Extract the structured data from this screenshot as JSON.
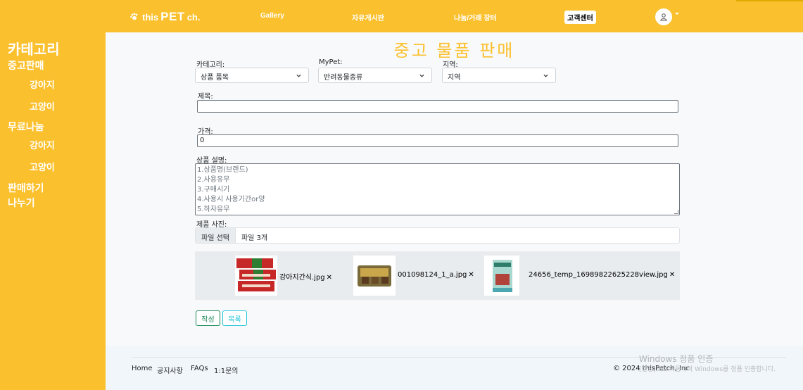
{
  "header": {
    "brand_prefix": "this",
    "brand_main": "PET",
    "brand_suffix": "ch.",
    "nav": [
      "Gallery",
      "자유게시판",
      "나눔/거래 장터"
    ],
    "customer_center": "고객센터",
    "accent_color": "#fbc02d"
  },
  "sidebar": {
    "title": "카테고리",
    "sections": [
      {
        "label": "중고판매",
        "items": [
          "강아지",
          "고양이"
        ]
      },
      {
        "label": "무료나눔",
        "items": [
          "강아지",
          "고양이"
        ]
      }
    ],
    "sell_label": "판매하기",
    "share_label": "나누기"
  },
  "page": {
    "title": "중고 물품 판매"
  },
  "form": {
    "category_label": "카테고리:",
    "category_value": "상품 품목",
    "mypet_label": "MyPet:",
    "mypet_value": "반려동물종류",
    "region_label": "지역:",
    "region_value": "지역",
    "title_label": "제목:",
    "title_value": "",
    "price_label": "가격:",
    "price_value": "0",
    "description_label": "상품 설명:",
    "description_placeholder_lines": [
      "1.상품명(브랜드)",
      "2.사용유무",
      "3.구매시기",
      "4.사용시 사용기간or양",
      "5.하자유무"
    ],
    "photos_label": "제품 사진:",
    "file_button": "파일 선택",
    "file_status": "파일 3개",
    "files": [
      {
        "name": "강아지간식.jpg",
        "remove": "✕"
      },
      {
        "name": "001098124_1_a.jpg",
        "remove": "✕"
      },
      {
        "name": "24656_temp_16989822625228view.jpg",
        "remove": "✕"
      }
    ],
    "submit_label": "작성",
    "list_label": "목록"
  },
  "footer": {
    "links": [
      "Home",
      "공지사항",
      "FAQs",
      "1:1문의"
    ],
    "copyright": "© 2024 thisPetch, Inc",
    "watermark_title": "Windows 정품 인증",
    "watermark_sub": "[설정]으로 이동하여 Windows를 정품 인증합니다."
  }
}
